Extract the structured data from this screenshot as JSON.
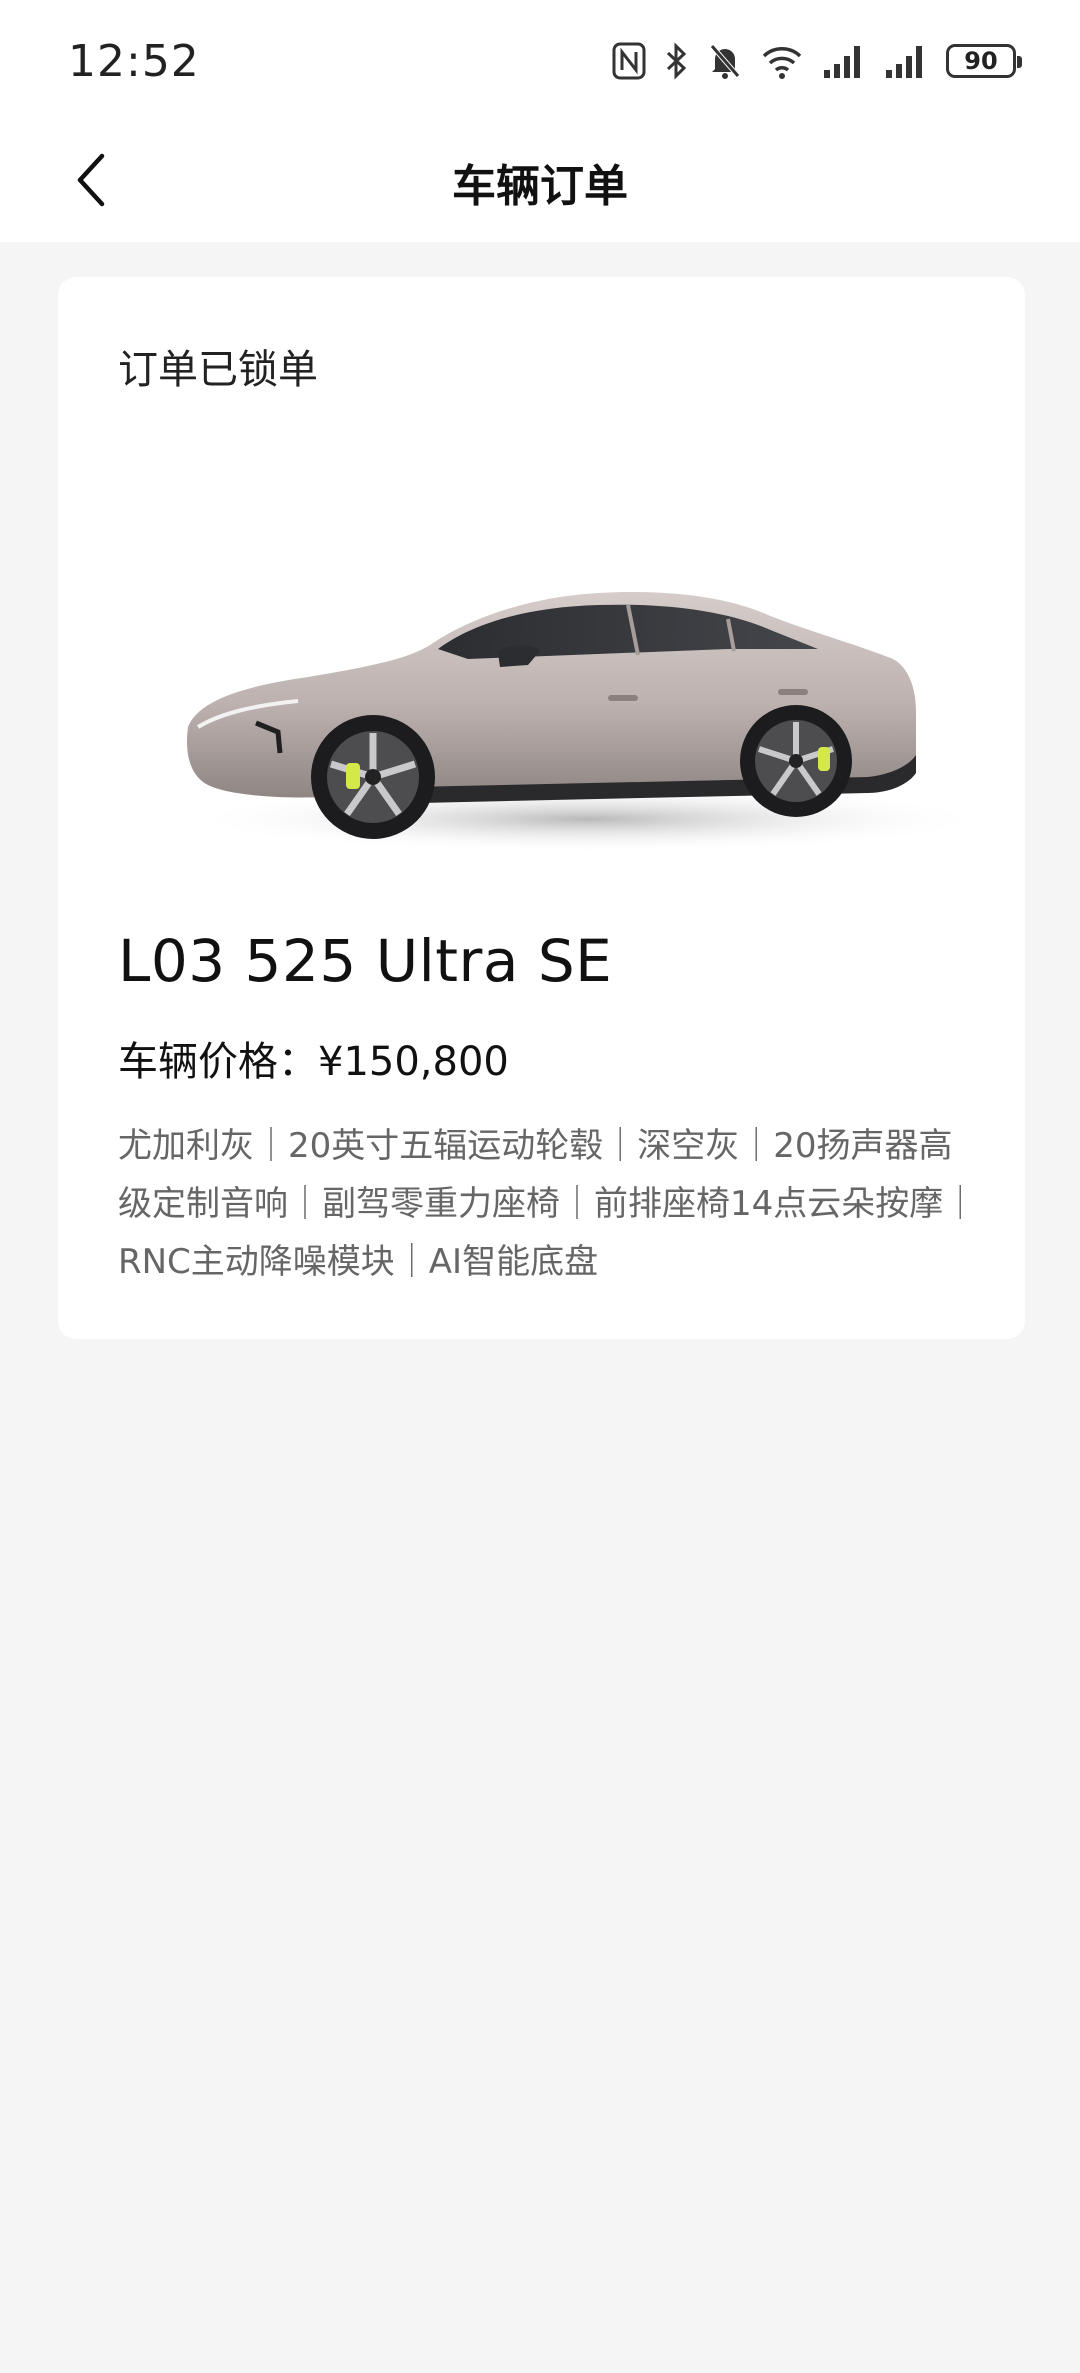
{
  "status_bar": {
    "time": "12:52",
    "battery": "90",
    "icons": [
      "nfc-icon",
      "bluetooth-icon",
      "mute-icon",
      "wifi-icon",
      "signal-icon",
      "signal-icon",
      "battery-icon"
    ]
  },
  "header": {
    "title": "车辆订单",
    "back_icon": "chevron-left-icon"
  },
  "order": {
    "status": "订单已锁单",
    "model": "L03 525 Ultra SE",
    "price_label": "车辆价格：",
    "price_value": "¥150,800",
    "options": "尤加利灰｜20英寸五辐运动轮毂｜深空灰｜20扬声器高级定制音响｜副驾零重力座椅｜前排座椅14点云朵按摩｜RNC主动降噪模块｜AI智能底盘"
  },
  "colors": {
    "background": "#f5f5f5",
    "card": "#ffffff",
    "text_primary": "#111111",
    "text_secondary": "#666666"
  }
}
